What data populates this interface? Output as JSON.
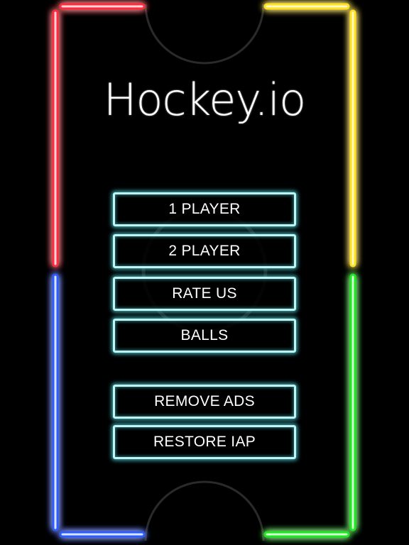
{
  "game": {
    "title": "Hockey.io"
  },
  "menu": {
    "one_player": "1 PLAYER",
    "two_player": "2 PLAYER",
    "rate_us": "RATE US",
    "balls": "BALLS",
    "remove_ads": "REMOVE ADS",
    "restore_iap": "RESTORE IAP"
  },
  "colors": {
    "top_left_wall": "#ff2a3a",
    "top_right_wall": "#ffe21a",
    "bottom_left_wall": "#2a5bff",
    "bottom_right_wall": "#1ee81e",
    "button_border": "#bff5f5",
    "button_glow": "#50dce6",
    "background": "#000000"
  },
  "icons": {
    "board": "neon-hockey-rink"
  }
}
